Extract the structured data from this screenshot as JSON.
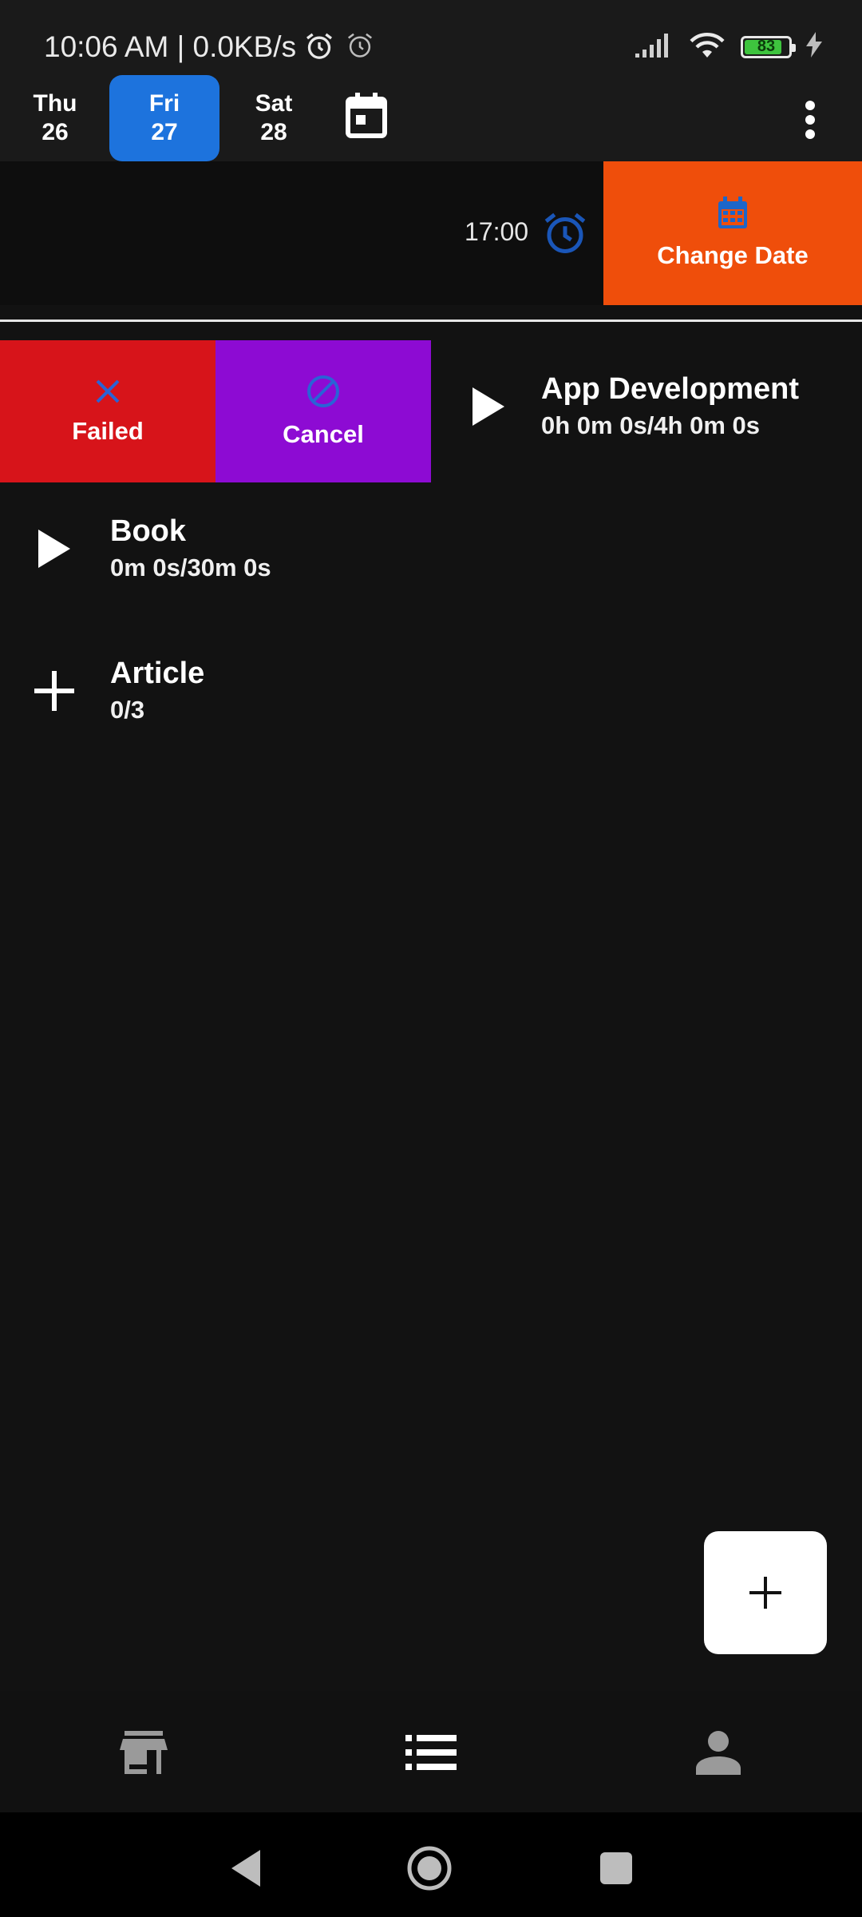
{
  "status_bar": {
    "time_text": "10:06 AM | 0.0KB/s",
    "battery": "83",
    "icons": [
      "alarm-clock-icon",
      "alarm-icon",
      "signal-icon",
      "wifi-icon",
      "battery-icon",
      "charging-bolt-icon"
    ]
  },
  "date_header": {
    "days": [
      {
        "day": "Thu",
        "date": "26",
        "selected": false
      },
      {
        "day": "Fri",
        "date": "27",
        "selected": true
      },
      {
        "day": "Sat",
        "date": "28",
        "selected": false
      }
    ],
    "selected_color": "#1d73dd"
  },
  "alarm_row": {
    "time": "17:00",
    "change_date_label": "Change Date",
    "change_date_color": "#ef4e0b"
  },
  "swipe_actions": {
    "failed_label": "Failed",
    "failed_color": "#d7141a",
    "cancel_label": "Cancel",
    "cancel_color": "#8d0bd3"
  },
  "tasks": [
    {
      "name": "App Development",
      "progress": "0h 0m 0s/4h 0m 0s",
      "icon": "play-icon"
    },
    {
      "name": "Book",
      "progress": "0m 0s/30m 0s",
      "icon": "play-icon"
    },
    {
      "name": "Article",
      "progress": "0/3",
      "icon": "plus-icon"
    }
  ],
  "bottom_nav": {
    "items": [
      "store-icon",
      "list-icon",
      "person-icon"
    ]
  }
}
